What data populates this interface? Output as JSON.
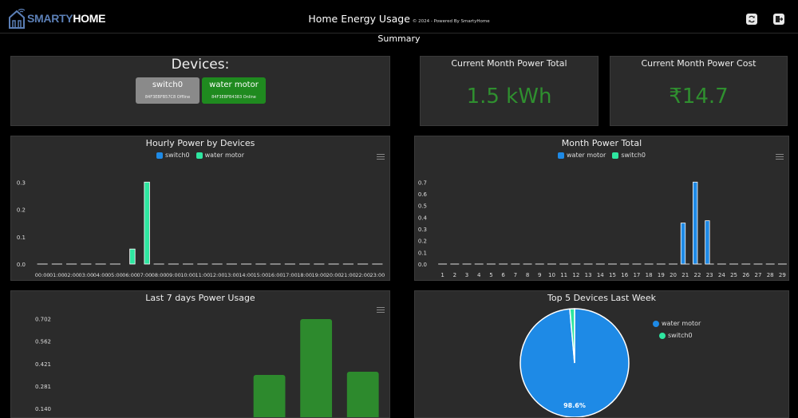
{
  "header": {
    "logo_a": "SMARTY",
    "logo_b": "HOME",
    "title": "Home Energy Usage",
    "subtitle": "© 2024 - Powered By SmartyHome"
  },
  "summary_label": "Summary",
  "devices_card": {
    "title": "Devices:",
    "devices": [
      {
        "name": "switch0",
        "status": "84F3EBFB57C8 Offline",
        "color": "#8a8a8a"
      },
      {
        "name": "water motor",
        "status": "84F3EBFB4383 Online",
        "color": "#1f8a1f"
      }
    ]
  },
  "power_total": {
    "title": "Current Month Power Total",
    "value": "1.5 kWh"
  },
  "power_cost": {
    "title": "Current Month Power Cost",
    "value": "₹14.7"
  },
  "colors": {
    "switch0": "#1e8ae6",
    "water_motor": "#2ee6a0",
    "week_bar": "#2d8a2d"
  },
  "hourly_chart": {
    "title": "Hourly Power by Devices",
    "legend": [
      "switch0",
      "water motor"
    ]
  },
  "month_chart": {
    "title": "Month Power Total",
    "legend": [
      "water motor",
      "switch0"
    ]
  },
  "week_chart": {
    "title": "Last 7 days Power Usage"
  },
  "pie_chart": {
    "title": "Top 5 Devices Last Week",
    "legend": [
      "water motor",
      "switch0"
    ],
    "label": "98.6%"
  },
  "chart_data": [
    {
      "type": "bar",
      "title": "Hourly Power by Devices",
      "categories": [
        "00:00",
        "01:00",
        "02:00",
        "03:00",
        "04:00",
        "05:00",
        "06:00",
        "07:00",
        "08:00",
        "09:00",
        "10:00",
        "11:00",
        "12:00",
        "13:00",
        "14:00",
        "15:00",
        "16:00",
        "17:00",
        "18:00",
        "19:00",
        "20:00",
        "21:00",
        "22:00",
        "23:00"
      ],
      "yticks": [
        "0.0",
        "0.1",
        "0.2",
        "0.3"
      ],
      "ylim": [
        0,
        0.33
      ],
      "series": [
        {
          "name": "switch0",
          "values": [
            0,
            0,
            0,
            0,
            0,
            0,
            0,
            0,
            0,
            0,
            0,
            0,
            0,
            0,
            0,
            0,
            0,
            0,
            0,
            0,
            0,
            0,
            0,
            0
          ]
        },
        {
          "name": "water motor",
          "values": [
            0,
            0,
            0,
            0,
            0,
            0,
            0.055,
            0.3,
            0,
            0,
            0,
            0,
            0,
            0,
            0,
            0,
            0,
            0,
            0,
            0,
            0,
            0,
            0,
            0
          ]
        }
      ]
    },
    {
      "type": "bar",
      "title": "Month Power Total",
      "categories": [
        "1",
        "2",
        "3",
        "4",
        "5",
        "6",
        "7",
        "8",
        "9",
        "10",
        "11",
        "12",
        "13",
        "14",
        "15",
        "16",
        "17",
        "18",
        "19",
        "20",
        "21",
        "22",
        "23",
        "24",
        "25",
        "26",
        "27",
        "28",
        "29"
      ],
      "yticks": [
        "0.0",
        "0.1",
        "0.2",
        "0.3",
        "0.4",
        "0.5",
        "0.6",
        "0.7"
      ],
      "ylim": [
        0,
        0.77
      ],
      "series": [
        {
          "name": "water motor",
          "values": [
            0,
            0,
            0,
            0,
            0,
            0,
            0,
            0,
            0,
            0,
            0,
            0,
            0,
            0,
            0,
            0,
            0,
            0,
            0,
            0,
            0.35,
            0.7,
            0.37,
            0,
            0,
            0,
            0,
            0,
            0
          ]
        },
        {
          "name": "switch0",
          "values": [
            0,
            0,
            0,
            0,
            0,
            0,
            0,
            0,
            0,
            0,
            0,
            0,
            0,
            0,
            0,
            0,
            0,
            0,
            0,
            0,
            0,
            0,
            0,
            0,
            0,
            0,
            0,
            0,
            0
          ]
        }
      ]
    },
    {
      "type": "bar",
      "title": "Last 7 days Power Usage",
      "yticks": [
        "0.140",
        "0.281",
        "0.421",
        "0.562",
        "0.702"
      ],
      "values": [
        0,
        0,
        0,
        0,
        0.35,
        0.7,
        0.37
      ]
    },
    {
      "type": "pie",
      "title": "Top 5 Devices Last Week",
      "slices": [
        {
          "name": "water motor",
          "value": 98.6
        },
        {
          "name": "switch0",
          "value": 1.4
        }
      ]
    }
  ]
}
